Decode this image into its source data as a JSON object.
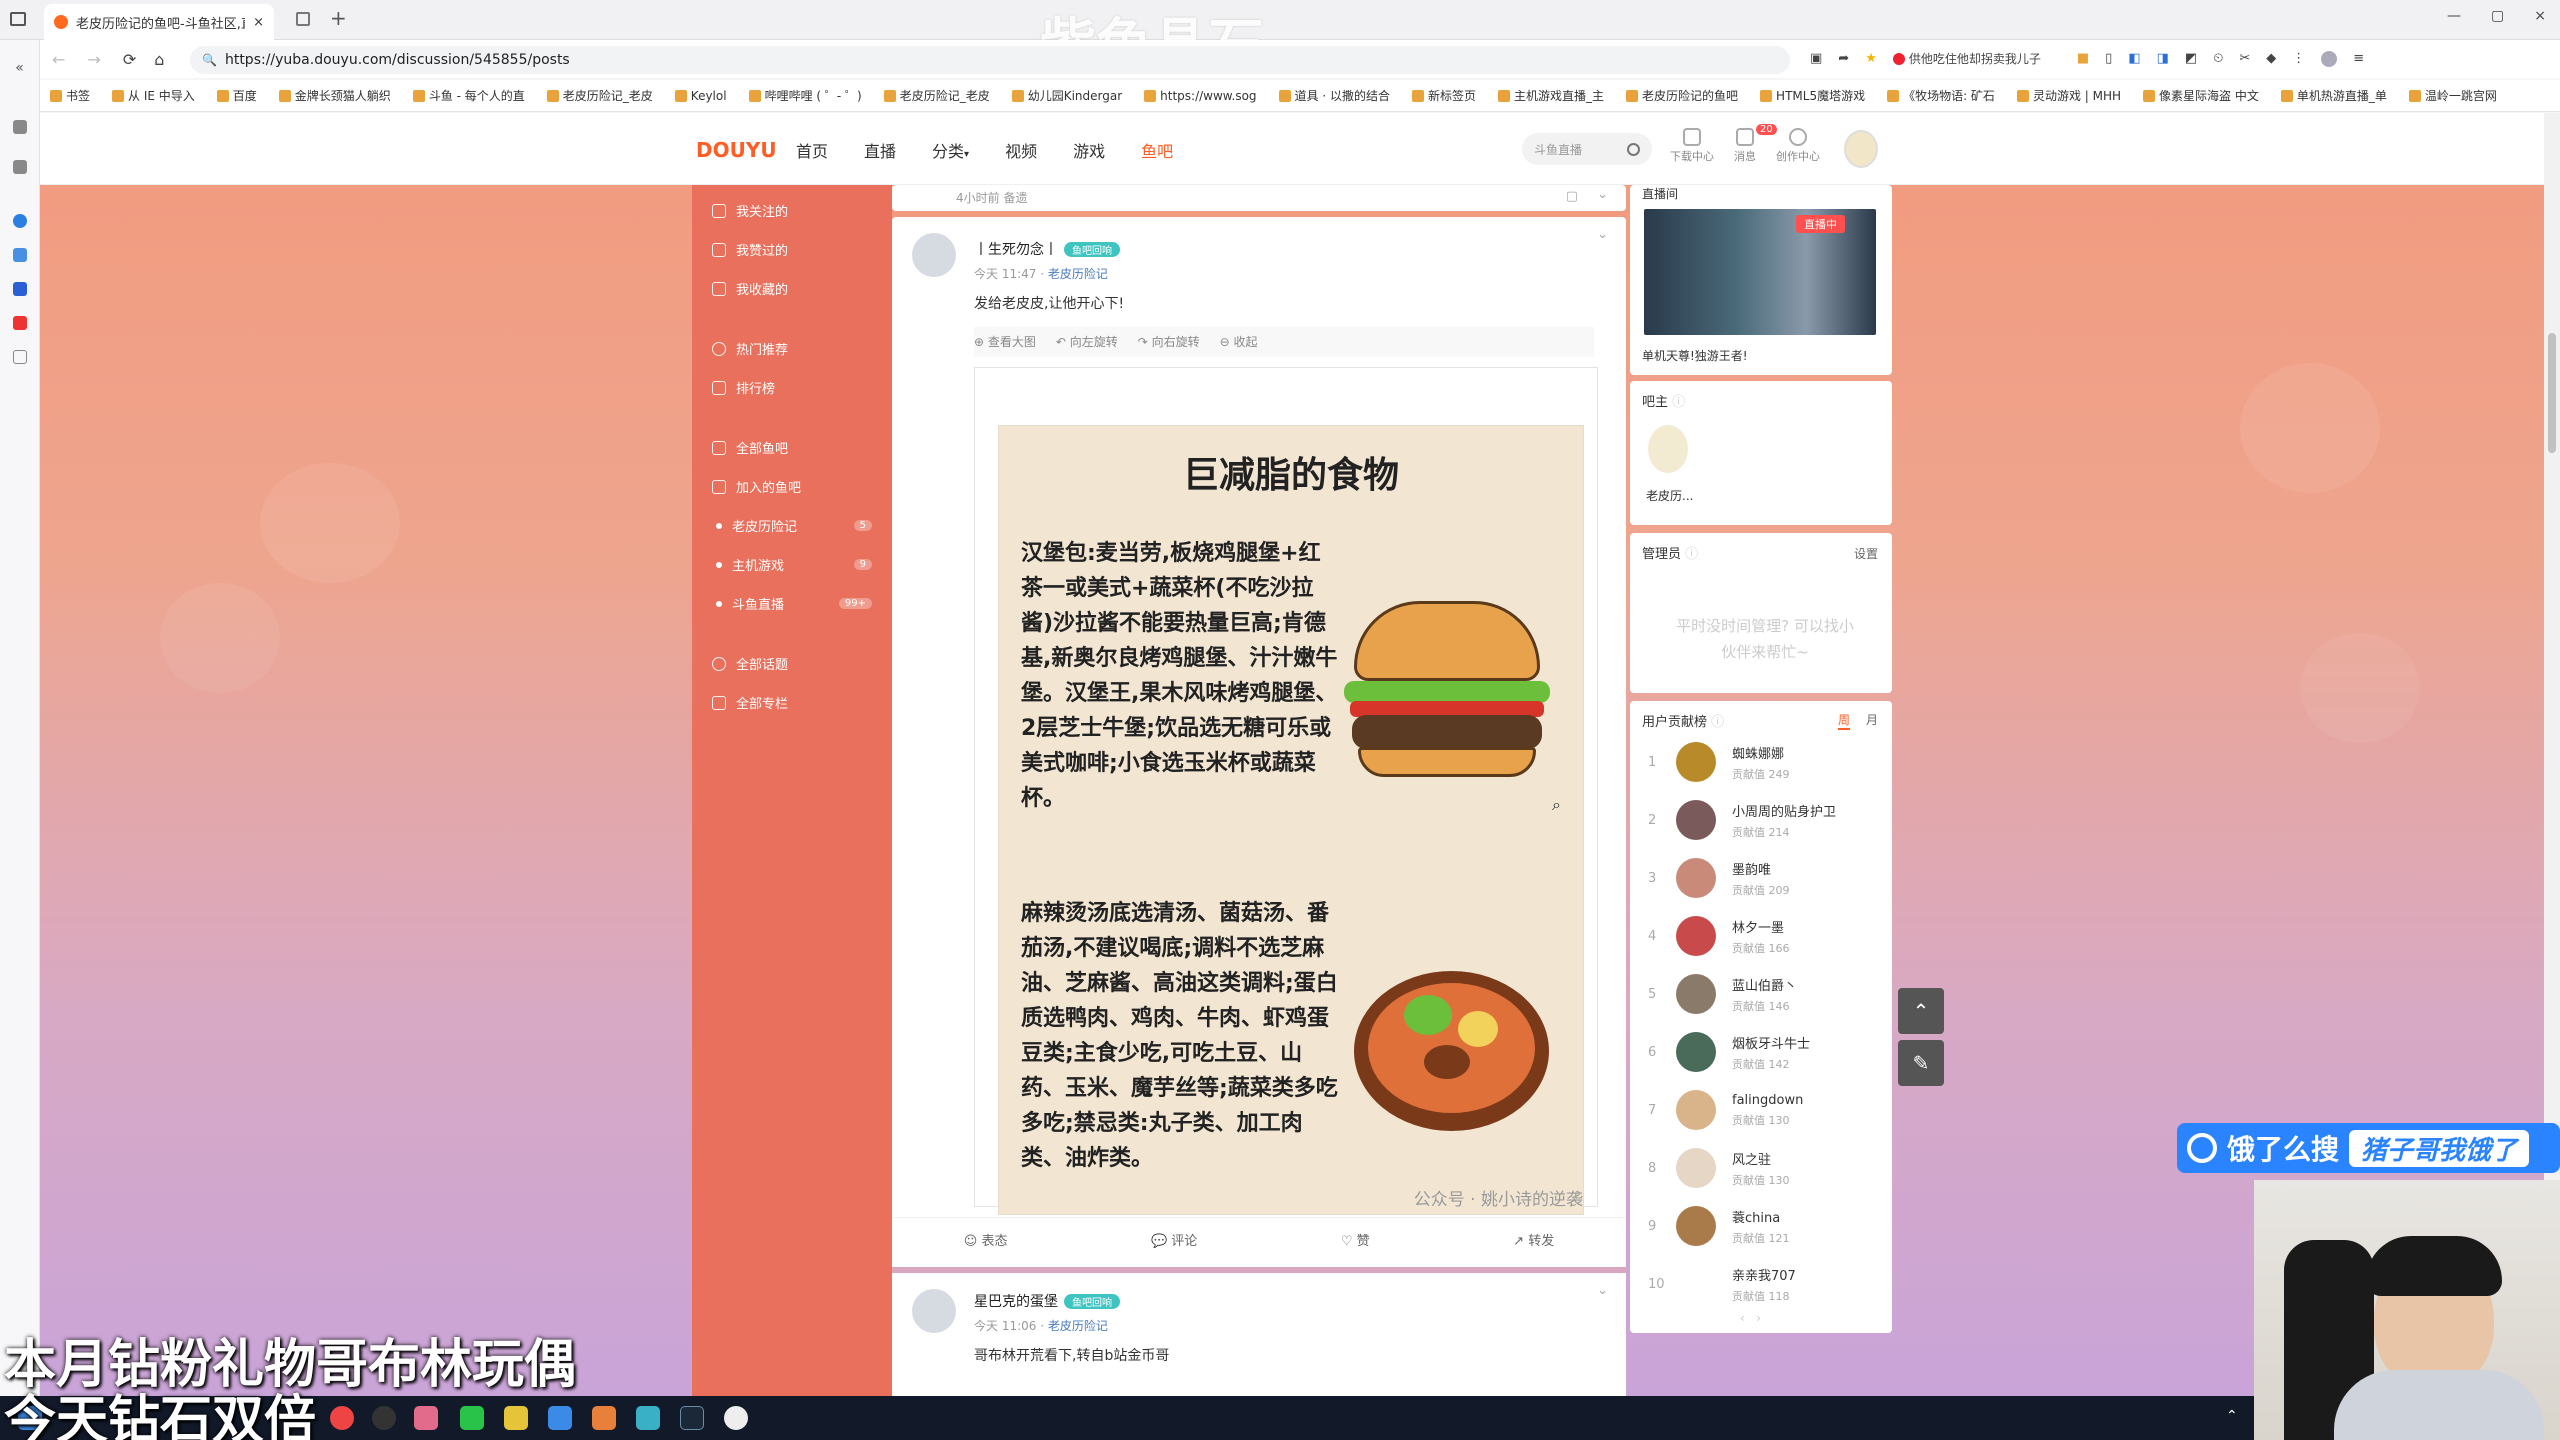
{
  "browser": {
    "tab_title": "老皮历险记的鱼吧-斗鱼社区,直播",
    "tab_close": "×",
    "new_tab": "+",
    "url": "https://yuba.douyu.com/discussion/545855/posts",
    "ext_label": "供他吃住他却拐卖我儿子",
    "window_controls": [
      "—",
      "▢",
      "×"
    ]
  },
  "bookmarks": [
    "书签",
    "从 IE 中导入",
    "百度",
    "金牌长颈猫人躺织",
    "斗鱼 - 每个人的直",
    "老皮历险记_老皮",
    "Keylol",
    "哔哩哔哩 ( ゜- ゜)",
    "老皮历险记_老皮",
    "幼儿园Kindergar",
    "https://www.sog",
    "道具 · 以撒的结合",
    "新标签页",
    "主机游戏直播_主",
    "老皮历险记的鱼吧",
    "HTML5魔塔游戏",
    "《牧场物语: 矿石",
    "灵动游戏 | MHH",
    "像素星际海盗 中文",
    "单机热游直播_单",
    "温岭一跳宫网"
  ],
  "watermark": "紫色晶石",
  "site": {
    "nav": [
      "首页",
      "直播",
      "分类",
      "视频",
      "游戏",
      "鱼吧"
    ],
    "search_placeholder": "斗鱼直播",
    "icons": [
      "下载中心",
      "消息",
      "创作中心"
    ],
    "msg_badge": "20"
  },
  "sidebar": {
    "items": [
      {
        "label": "我关注的",
        "count": ""
      },
      {
        "label": "我赞过的",
        "count": ""
      },
      {
        "label": "我收藏的",
        "count": ""
      },
      {
        "label": "热门推荐",
        "count": ""
      },
      {
        "label": "排行榜",
        "count": ""
      },
      {
        "label": "全部鱼吧",
        "count": ""
      },
      {
        "label": "加入的鱼吧",
        "count": ""
      },
      {
        "label": "老皮历险记",
        "count": "5"
      },
      {
        "label": "主机游戏",
        "count": "9"
      },
      {
        "label": "斗鱼直播",
        "count": "99+"
      },
      {
        "label": "全部话题",
        "count": ""
      },
      {
        "label": "全部专栏",
        "count": ""
      }
    ]
  },
  "posts": [
    {
      "meta_time": "4小时前",
      "meta_extra": "备遗"
    },
    {
      "author": "丨生死勿念丨",
      "tag": "鱼吧回响",
      "time": "今天 11:47",
      "group": "老皮历险记",
      "text": "发给老皮皮,让他开心下!",
      "tools": [
        "查看大图",
        "向左旋转",
        "向右旋转",
        "收起"
      ],
      "image": {
        "title": "巨减脂的食物",
        "para1": "汉堡包:麦当劳,板烧鸡腿堡+红茶一或美式+蔬菜杯(不吃沙拉酱)沙拉酱不能要热量巨高;肯德基,新奥尔良烤鸡腿堡、汁汁嫩牛堡。汉堡王,果木风味烤鸡腿堡、2层芝士牛堡;饮品选无糖可乐或美式咖啡;小食选玉米杯或蔬菜杯。",
        "para2": "麻辣烫汤底选清汤、菌菇汤、番茄汤,不建议喝底;调料不选芝麻油、芝麻酱、高油这类调料;蛋白质选鸭肉、鸡肉、牛肉、虾鸡蛋豆类;主食少吃,可吃土豆、山药、玉米、魔芋丝等;蔬菜类多吃多吃;禁忌类:丸子类、加工肉类、油炸类。",
        "watermark": "公众号 · 姚小诗的逆袭"
      },
      "actions": [
        "表态",
        "评论",
        "赞",
        "转发"
      ]
    },
    {
      "author": "星巴克的蛋堡",
      "tag": "鱼吧回响",
      "time": "今天 11:06",
      "group": "老皮历险记",
      "text": "哥布林开荒看下,转自b站金币哥"
    }
  ],
  "right": {
    "live_label": "直播间",
    "live_badge": "直播中",
    "live_caption": "单机天尊!独游王者!",
    "owner_title": "吧主",
    "owner_name": "老皮历...",
    "admin_title": "管理员",
    "admin_set": "设置",
    "admin_empty": "平时没时间管理? 可以找小伙伴来帮忙~",
    "rank_title": "用户贡献榜",
    "rank_tabs": [
      "周",
      "月"
    ],
    "rank_score_label": "贡献值",
    "ranks": [
      {
        "no": "1",
        "name": "蜘蛛娜娜",
        "score": "249",
        "color": "#b98a2a"
      },
      {
        "no": "2",
        "name": "小周周的贴身护卫",
        "score": "214",
        "color": "#7a5a5a"
      },
      {
        "no": "3",
        "name": "墨韵唯",
        "score": "209",
        "color": "#c98a7a"
      },
      {
        "no": "4",
        "name": "林夕一墨",
        "score": "166",
        "color": "#c94a4a"
      },
      {
        "no": "5",
        "name": "蓝山伯爵丶",
        "score": "146",
        "color": "#8a7a6a"
      },
      {
        "no": "6",
        "name": "烟板牙斗牛士",
        "score": "142",
        "color": "#4a6a5a"
      },
      {
        "no": "7",
        "name": "falingdown",
        "score": "130",
        "color": "#d9b48a"
      },
      {
        "no": "8",
        "name": "风之驻",
        "score": "130",
        "color": "#e6d6c6"
      },
      {
        "no": "9",
        "name": "蓑china",
        "score": "121",
        "color": "#a97a4a"
      },
      {
        "no": "10",
        "name": "亲亲我707",
        "score": "118",
        "color": "#ffffff"
      }
    ]
  },
  "overlay": {
    "line1": "本月钻粉礼物哥布林玩偶",
    "line2": "今天钻石双倍",
    "promo1": "饿了么搜",
    "promo2": "猪子哥我饿了"
  }
}
